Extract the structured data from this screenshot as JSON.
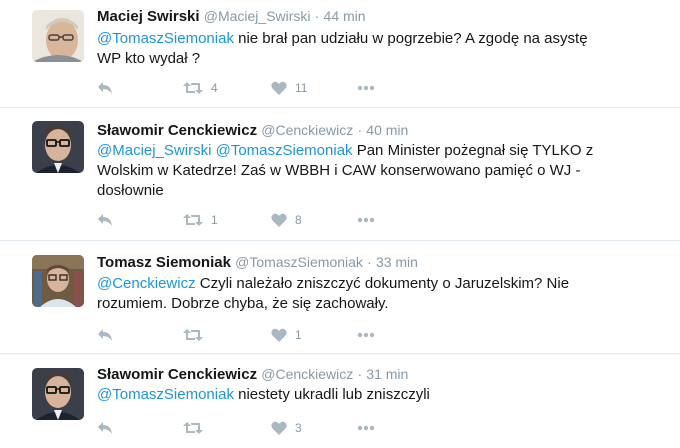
{
  "icons": {
    "reply": "reply-icon",
    "retweet": "retweet-icon",
    "like": "heart-icon",
    "more": "more-icon"
  },
  "colors": {
    "mention": "#1b95e0",
    "meta": "#8899a6",
    "icon": "#aab8c2",
    "divider": "#e1e8ed"
  },
  "tweets": [
    {
      "name": "Maciej Swirski",
      "handle": "@Maciej_Swirski",
      "sep": "·",
      "time": "44 min",
      "mentions": [
        "@TomaszSiemoniak"
      ],
      "line1": " nie brał pan udziału w pogrzebie? A zgodę na asystę",
      "line2": "WP kto wydał ?",
      "retweets": "4",
      "likes": "11"
    },
    {
      "name": "Sławomir Cenckiewicz",
      "handle": "@Cenckiewicz",
      "sep": "·",
      "time": "40 min",
      "mentions": [
        "@Maciej_Swirski",
        "@TomaszSiemoniak"
      ],
      "line1": " Pan Minister pożegnał się TYLKO z",
      "line2": "Wolskim w Katedrze! Zaś w WBBH i CAW konserwowano pamięć o WJ -",
      "line3": "dosłownie",
      "retweets": "1",
      "likes": "8"
    },
    {
      "name": "Tomasz Siemoniak",
      "handle": "@TomaszSiemoniak",
      "sep": "·",
      "time": "33 min",
      "mentions": [
        "@Cenckiewicz"
      ],
      "line1": " Czyli należało zniszczyć dokumenty o Jaruzelskim? Nie",
      "line2": "rozumiem. Dobrze chyba, że się zachowały.",
      "retweets": "",
      "likes": "1"
    },
    {
      "name": "Sławomir Cenckiewicz",
      "handle": "@Cenckiewicz",
      "sep": "·",
      "time": "31 min",
      "mentions": [
        "@TomaszSiemoniak"
      ],
      "line1": " niestety ukradli lub zniszczyli",
      "retweets": "",
      "likes": "3"
    }
  ]
}
